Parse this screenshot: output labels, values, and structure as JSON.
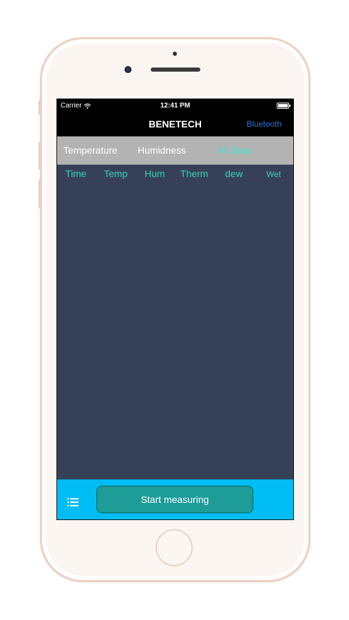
{
  "status_bar": {
    "carrier": "Carrier",
    "time": "12:41 PM"
  },
  "nav": {
    "title": "BENETECH",
    "right_button": "Bluetooth"
  },
  "segments": [
    {
      "label": "Temperature",
      "active": false
    },
    {
      "label": "Humidness",
      "active": false
    },
    {
      "label": "All Data",
      "active": true
    }
  ],
  "columns": [
    "Time",
    "Temp",
    "Hum",
    "Therm",
    "dew",
    "Wet"
  ],
  "bottom": {
    "start_label": "Start measuring",
    "menu_icon": "list-icon"
  },
  "colors": {
    "nav_background": "#000000",
    "segment_background": "#b3b3b3",
    "accent_teal": "#43e3c9",
    "content_background": "#364158",
    "bottom_bar": "#00bdf6",
    "start_button": "#1d9c98",
    "bluetooth_link": "#2f73e0"
  }
}
